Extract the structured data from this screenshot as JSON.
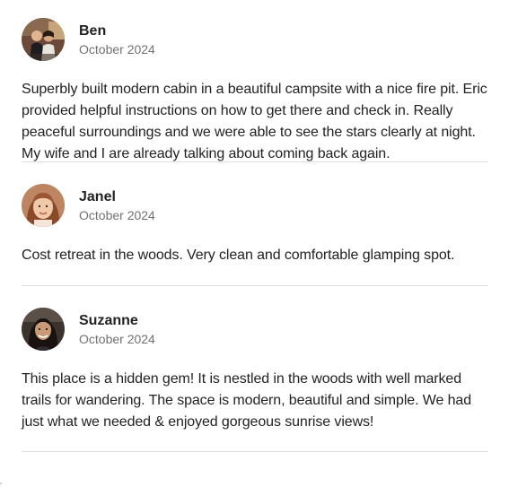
{
  "reviews": [
    {
      "name": "Ben",
      "date": "October 2024",
      "avatar": "ben-avatar-photo",
      "text": "Superbly built modern cabin in a beautiful campsite with a nice fire pit. Eric provided helpful instructions on how to get there and check in. Really peaceful surroundings and we were able to see the stars clearly at night. My wife and I are already talking about coming back again."
    },
    {
      "name": "Janel",
      "date": "October 2024",
      "avatar": "janel-avatar-photo",
      "text": "Cost retreat in the woods. Very clean and comfortable glamping spot."
    },
    {
      "name": "Suzanne",
      "date": "October 2024",
      "avatar": "suzanne-avatar-photo",
      "text": "This place is a hidden gem! It is nestled in the woods with well marked trails for wandering. The space is modern, beautiful and simple. We had just what we needed & enjoyed gorgeous sunrise views!"
    }
  ],
  "colors": {
    "text": "#222222",
    "secondary_text": "#717171",
    "divider": "#dddddd"
  }
}
